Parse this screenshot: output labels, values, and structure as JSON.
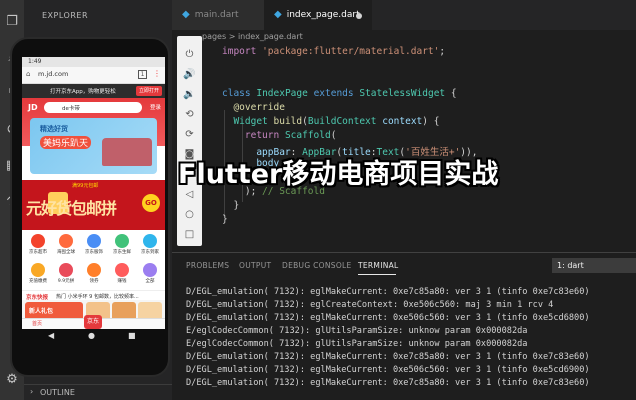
{
  "sidebar": {
    "title": "EXPLORER",
    "outline_label": "OUTLINE"
  },
  "tabs": [
    {
      "label": "main.dart"
    },
    {
      "label": "index_page.dart"
    }
  ],
  "breadcrumb": "pages  >  index_page.dart",
  "code": [
    "import 'package:flutter/material.dart';",
    "",
    "",
    "class IndexPage extends StatelessWidget {",
    "  @override",
    "  Widget build(BuildContext context) {",
    "    return Scaffold(",
    "      appBar: AppBar(title:Text('百姓生活+')),",
    "      body"
  ],
  "code_tail": [
    "    ); // Scaffold",
    "  }",
    "}"
  ],
  "phone": {
    "time": "1:49",
    "url": "m.jd.com",
    "app_banner": "打开京东App，购物更轻松",
    "app_banner_btn": "立即打开",
    "logo": "JD",
    "search": "de卡带",
    "login": "登录",
    "hero_tag": "精选好货",
    "hero_title": "美妈乐趴天",
    "promo_sub": "满99元包邮",
    "promo_big": "元好货包邮拼",
    "promo_go": "GO",
    "icons": [
      "京东超市",
      "海囤全球",
      "京东服饰",
      "京东生鲜",
      "京东到家",
      "充值缴费",
      "9.9元拼",
      "领券",
      "赚钱",
      "全部"
    ],
    "news_brand": "京东快报",
    "news_text": "热门  小米手环 9 包邮数，比较频率...",
    "gift": "新人礼包",
    "nav_home": "首页",
    "nav_jd": "京东"
  },
  "panel": {
    "tabs": [
      "PROBLEMS",
      "OUTPUT",
      "DEBUG CONSOLE",
      "TERMINAL"
    ],
    "terminal_select": "1: dart",
    "lines": [
      "D/EGL_emulation( 7132): eglMakeCurrent: 0xe7c85a80: ver 3 1 (tinfo 0xe7c83e60)",
      "D/EGL_emulation( 7132): eglCreateContext: 0xe506c560: maj 3 min 1 rcv 4",
      "D/EGL_emulation( 7132): eglMakeCurrent: 0xe506c560: ver 3 1 (tinfo 0xe5cd6800)",
      "E/eglCodecCommon( 7132): glUtilsParamSize: unknow param 0x000082da",
      "E/eglCodecCommon( 7132): glUtilsParamSize: unknow param 0x000082da",
      "D/EGL_emulation( 7132): eglMakeCurrent: 0xe7c85a80: ver 3 1 (tinfo 0xe7c83e60)",
      "D/EGL_emulation( 7132): eglMakeCurrent: 0xe506c560: ver 3 1 (tinfo 0xe5cd6900)",
      "D/EGL_emulation( 7132): eglMakeCurrent: 0xe7c85a80: ver 3 1 (tinfo 0xe7c83e60)"
    ]
  },
  "overlay_title": "Flutter移动电商项目实战",
  "colors": {
    "editor_bg": "#1e1e1e",
    "sidebar_bg": "#252526",
    "jd_red": "#e4393c"
  }
}
